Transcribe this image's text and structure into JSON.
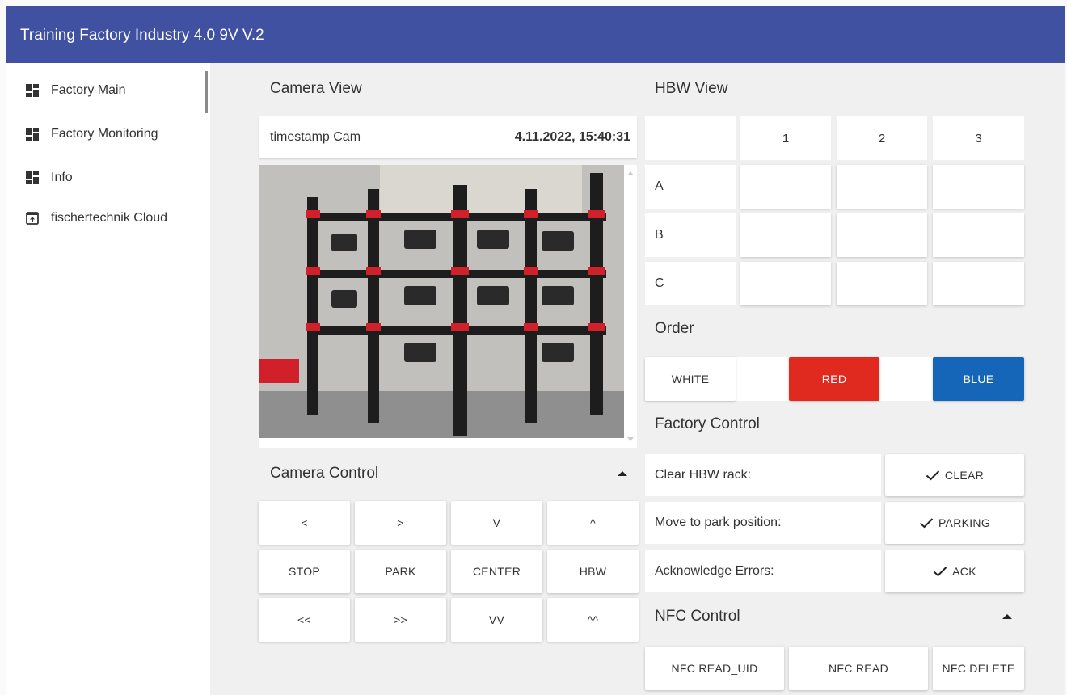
{
  "app": {
    "title": "Training Factory Industry 4.0 9V V.2"
  },
  "sidebar": {
    "items": [
      {
        "label": "Factory Main",
        "icon": "dashboard-icon"
      },
      {
        "label": "Factory Monitoring",
        "icon": "dashboard-icon"
      },
      {
        "label": "Info",
        "icon": "dashboard-icon"
      },
      {
        "label": "fischertechnik Cloud",
        "icon": "open-in-browser-icon"
      }
    ]
  },
  "camera_view": {
    "title": "Camera View",
    "timestamp_label": "timestamp Cam",
    "timestamp_value": "4.11.2022, 15:40:31"
  },
  "camera_control": {
    "title": "Camera Control",
    "rows": [
      [
        "<",
        ">",
        "V",
        "^"
      ],
      [
        "STOP",
        "PARK",
        "CENTER",
        "HBW"
      ],
      [
        "<<",
        ">>",
        "VV",
        "^^"
      ]
    ]
  },
  "hbw_view": {
    "title": "HBW View",
    "columns": [
      "1",
      "2",
      "3"
    ],
    "rows": [
      "A",
      "B",
      "C"
    ]
  },
  "order": {
    "title": "Order",
    "buttons": [
      {
        "label": "WHITE",
        "color": "#ffffff"
      },
      {
        "label": "RED",
        "color": "#e02a1f"
      },
      {
        "label": "BLUE",
        "color": "#1565b8"
      }
    ]
  },
  "factory_control": {
    "title": "Factory Control",
    "rows": [
      {
        "label": "Clear HBW rack:",
        "button": "CLEAR"
      },
      {
        "label": "Move to park position:",
        "button": "PARKING"
      },
      {
        "label": "Acknowledge Errors:",
        "button": "ACK"
      }
    ]
  },
  "nfc_control": {
    "title": "NFC Control",
    "buttons": [
      "NFC READ_UID",
      "NFC READ",
      "NFC DELETE"
    ]
  },
  "colors": {
    "header": "#3f51a0",
    "red": "#e02a1f",
    "blue": "#1565b8"
  }
}
